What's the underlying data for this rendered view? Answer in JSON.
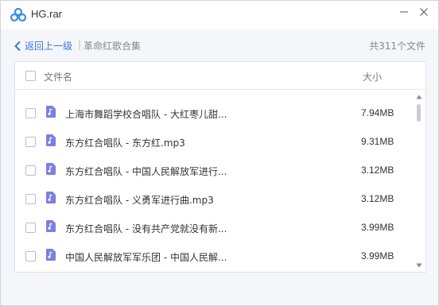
{
  "window": {
    "title": "HG.rar"
  },
  "nav": {
    "back_label": "返回上一级",
    "separator": "|",
    "current_folder": "革命红歌合集",
    "file_count": "共311个文件"
  },
  "table": {
    "col_name": "文件名",
    "col_size": "大小",
    "rows": [
      {
        "name": "上海市舞蹈学校合唱队 - 大红枣儿甜...",
        "size": "7.94MB"
      },
      {
        "name": "东方红合唱队 - 东方红.mp3",
        "size": "9.31MB"
      },
      {
        "name": "东方红合唱队 - 中国人民解放军进行...",
        "size": "3.12MB"
      },
      {
        "name": "东方红合唱队 - 义勇军进行曲.mp3",
        "size": "3.12MB"
      },
      {
        "name": "东方红合唱队 - 没有共产党就没有新...",
        "size": "3.99MB"
      },
      {
        "name": "中国人民解放军军乐团 - 中国人民解...",
        "size": "3.99MB"
      }
    ]
  },
  "icons": {
    "logo": "cloud-logo-icon",
    "minimize": "minimize-icon",
    "close": "close-icon",
    "back": "chevron-left-icon",
    "file": "music-file-icon"
  },
  "colors": {
    "accent": "#3b7ad9",
    "music_icon": "#7b7fe0",
    "logo_blue": "#3d8be8"
  }
}
